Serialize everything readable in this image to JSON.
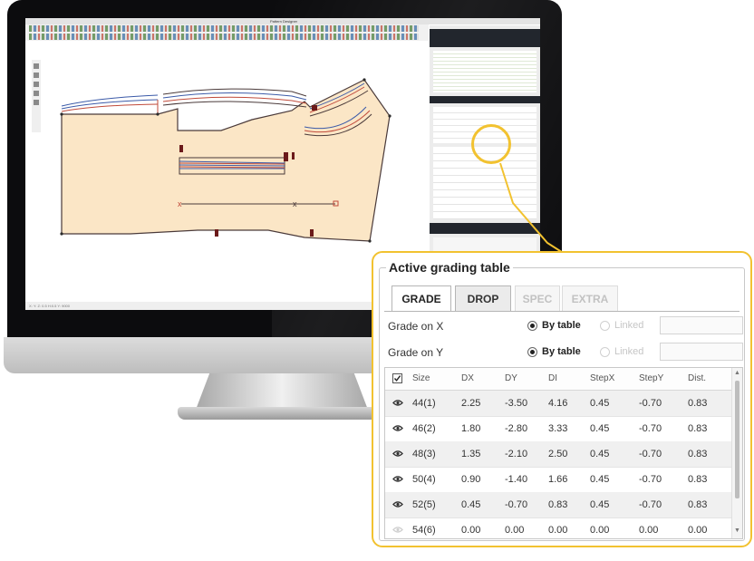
{
  "app": {
    "window_title": "Pattern Designer",
    "status_text": "X: Y: Z: 0.5 H:0.5 Y: 9000"
  },
  "colors": {
    "highlight": "#f2c230",
    "pattern_fill": "#fbe6c6",
    "pattern_outline": "#4a3a3a",
    "panel_dark": "#22262d"
  },
  "icons": [
    "pointer-icon",
    "zoom-icon",
    "pen-icon",
    "measure-icon",
    "cut-icon"
  ],
  "grading_panel": {
    "title": "Active grading table",
    "tabs": [
      {
        "label": "GRADE",
        "state": "active"
      },
      {
        "label": "DROP",
        "state": "normal"
      },
      {
        "label": "SPEC",
        "state": "disabled"
      },
      {
        "label": "EXTRA",
        "state": "disabled"
      }
    ],
    "grade_x": {
      "label": "Grade on X",
      "option1": "By table",
      "option2": "Linked"
    },
    "grade_y": {
      "label": "Grade on Y",
      "option1": "By table",
      "option2": "Linked"
    },
    "columns": [
      "Size",
      "DX",
      "DY",
      "DI",
      "StepX",
      "StepY",
      "Dist."
    ],
    "rows": [
      {
        "size": "44(1)",
        "dx": "2.25",
        "dy": "-3.50",
        "di": "4.16",
        "stepx": "0.45",
        "stepy": "-0.70",
        "dist": "0.83"
      },
      {
        "size": "46(2)",
        "dx": "1.80",
        "dy": "-2.80",
        "di": "3.33",
        "stepx": "0.45",
        "stepy": "-0.70",
        "dist": "0.83"
      },
      {
        "size": "48(3)",
        "dx": "1.35",
        "dy": "-2.10",
        "di": "2.50",
        "stepx": "0.45",
        "stepy": "-0.70",
        "dist": "0.83"
      },
      {
        "size": "50(4)",
        "dx": "0.90",
        "dy": "-1.40",
        "di": "1.66",
        "stepx": "0.45",
        "stepy": "-0.70",
        "dist": "0.83"
      },
      {
        "size": "52(5)",
        "dx": "0.45",
        "dy": "-0.70",
        "di": "0.83",
        "stepx": "0.45",
        "stepy": "-0.70",
        "dist": "0.83"
      },
      {
        "size": "54(6)",
        "dx": "0.00",
        "dy": "0.00",
        "di": "0.00",
        "stepx": "0.00",
        "stepy": "0.00",
        "dist": "0.00"
      }
    ]
  }
}
